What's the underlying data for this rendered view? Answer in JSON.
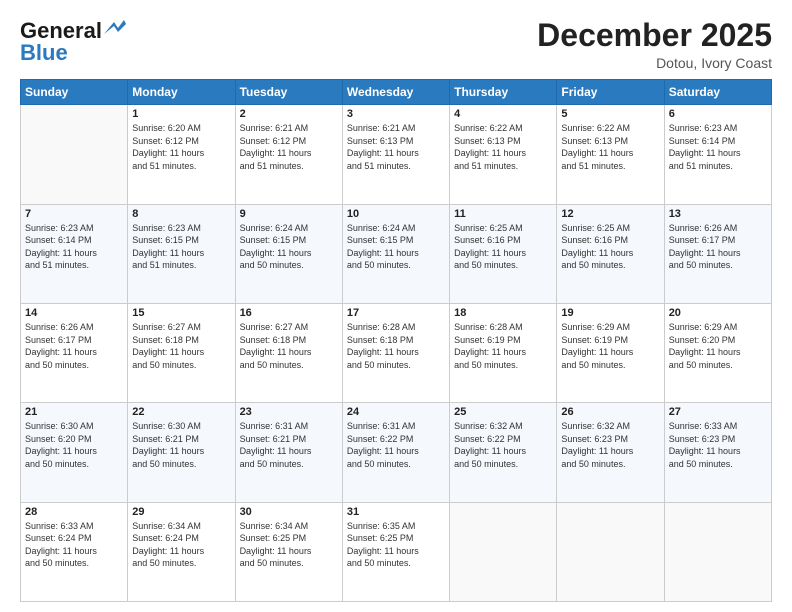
{
  "header": {
    "logo_line1": "General",
    "logo_line2": "Blue",
    "month": "December 2025",
    "location": "Dotou, Ivory Coast"
  },
  "days_of_week": [
    "Sunday",
    "Monday",
    "Tuesday",
    "Wednesday",
    "Thursday",
    "Friday",
    "Saturday"
  ],
  "weeks": [
    [
      {
        "day": "",
        "info": ""
      },
      {
        "day": "1",
        "info": "Sunrise: 6:20 AM\nSunset: 6:12 PM\nDaylight: 11 hours\nand 51 minutes."
      },
      {
        "day": "2",
        "info": "Sunrise: 6:21 AM\nSunset: 6:12 PM\nDaylight: 11 hours\nand 51 minutes."
      },
      {
        "day": "3",
        "info": "Sunrise: 6:21 AM\nSunset: 6:13 PM\nDaylight: 11 hours\nand 51 minutes."
      },
      {
        "day": "4",
        "info": "Sunrise: 6:22 AM\nSunset: 6:13 PM\nDaylight: 11 hours\nand 51 minutes."
      },
      {
        "day": "5",
        "info": "Sunrise: 6:22 AM\nSunset: 6:13 PM\nDaylight: 11 hours\nand 51 minutes."
      },
      {
        "day": "6",
        "info": "Sunrise: 6:23 AM\nSunset: 6:14 PM\nDaylight: 11 hours\nand 51 minutes."
      }
    ],
    [
      {
        "day": "7",
        "info": "Sunrise: 6:23 AM\nSunset: 6:14 PM\nDaylight: 11 hours\nand 51 minutes."
      },
      {
        "day": "8",
        "info": "Sunrise: 6:23 AM\nSunset: 6:15 PM\nDaylight: 11 hours\nand 51 minutes."
      },
      {
        "day": "9",
        "info": "Sunrise: 6:24 AM\nSunset: 6:15 PM\nDaylight: 11 hours\nand 50 minutes."
      },
      {
        "day": "10",
        "info": "Sunrise: 6:24 AM\nSunset: 6:15 PM\nDaylight: 11 hours\nand 50 minutes."
      },
      {
        "day": "11",
        "info": "Sunrise: 6:25 AM\nSunset: 6:16 PM\nDaylight: 11 hours\nand 50 minutes."
      },
      {
        "day": "12",
        "info": "Sunrise: 6:25 AM\nSunset: 6:16 PM\nDaylight: 11 hours\nand 50 minutes."
      },
      {
        "day": "13",
        "info": "Sunrise: 6:26 AM\nSunset: 6:17 PM\nDaylight: 11 hours\nand 50 minutes."
      }
    ],
    [
      {
        "day": "14",
        "info": "Sunrise: 6:26 AM\nSunset: 6:17 PM\nDaylight: 11 hours\nand 50 minutes."
      },
      {
        "day": "15",
        "info": "Sunrise: 6:27 AM\nSunset: 6:18 PM\nDaylight: 11 hours\nand 50 minutes."
      },
      {
        "day": "16",
        "info": "Sunrise: 6:27 AM\nSunset: 6:18 PM\nDaylight: 11 hours\nand 50 minutes."
      },
      {
        "day": "17",
        "info": "Sunrise: 6:28 AM\nSunset: 6:18 PM\nDaylight: 11 hours\nand 50 minutes."
      },
      {
        "day": "18",
        "info": "Sunrise: 6:28 AM\nSunset: 6:19 PM\nDaylight: 11 hours\nand 50 minutes."
      },
      {
        "day": "19",
        "info": "Sunrise: 6:29 AM\nSunset: 6:19 PM\nDaylight: 11 hours\nand 50 minutes."
      },
      {
        "day": "20",
        "info": "Sunrise: 6:29 AM\nSunset: 6:20 PM\nDaylight: 11 hours\nand 50 minutes."
      }
    ],
    [
      {
        "day": "21",
        "info": "Sunrise: 6:30 AM\nSunset: 6:20 PM\nDaylight: 11 hours\nand 50 minutes."
      },
      {
        "day": "22",
        "info": "Sunrise: 6:30 AM\nSunset: 6:21 PM\nDaylight: 11 hours\nand 50 minutes."
      },
      {
        "day": "23",
        "info": "Sunrise: 6:31 AM\nSunset: 6:21 PM\nDaylight: 11 hours\nand 50 minutes."
      },
      {
        "day": "24",
        "info": "Sunrise: 6:31 AM\nSunset: 6:22 PM\nDaylight: 11 hours\nand 50 minutes."
      },
      {
        "day": "25",
        "info": "Sunrise: 6:32 AM\nSunset: 6:22 PM\nDaylight: 11 hours\nand 50 minutes."
      },
      {
        "day": "26",
        "info": "Sunrise: 6:32 AM\nSunset: 6:23 PM\nDaylight: 11 hours\nand 50 minutes."
      },
      {
        "day": "27",
        "info": "Sunrise: 6:33 AM\nSunset: 6:23 PM\nDaylight: 11 hours\nand 50 minutes."
      }
    ],
    [
      {
        "day": "28",
        "info": "Sunrise: 6:33 AM\nSunset: 6:24 PM\nDaylight: 11 hours\nand 50 minutes."
      },
      {
        "day": "29",
        "info": "Sunrise: 6:34 AM\nSunset: 6:24 PM\nDaylight: 11 hours\nand 50 minutes."
      },
      {
        "day": "30",
        "info": "Sunrise: 6:34 AM\nSunset: 6:25 PM\nDaylight: 11 hours\nand 50 minutes."
      },
      {
        "day": "31",
        "info": "Sunrise: 6:35 AM\nSunset: 6:25 PM\nDaylight: 11 hours\nand 50 minutes."
      },
      {
        "day": "",
        "info": ""
      },
      {
        "day": "",
        "info": ""
      },
      {
        "day": "",
        "info": ""
      }
    ]
  ]
}
